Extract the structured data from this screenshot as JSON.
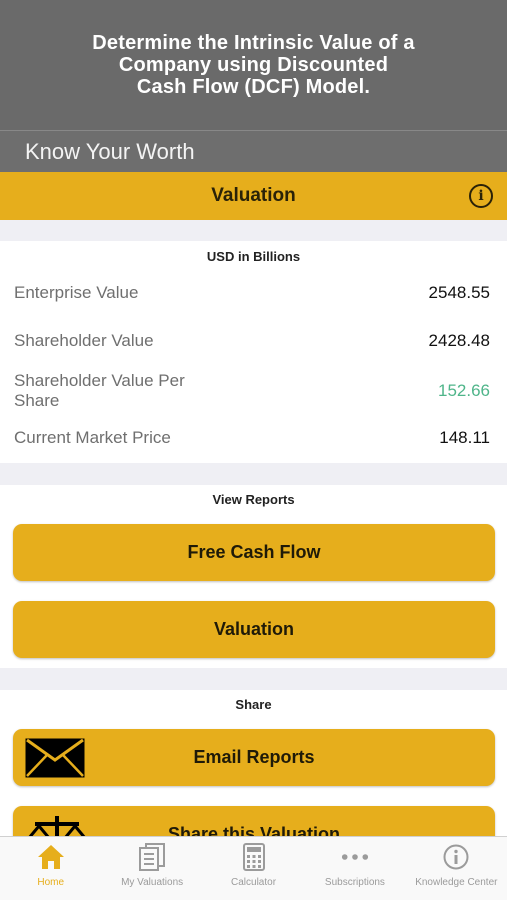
{
  "promo": {
    "text": "Determine the Intrinsic Value of a\nCompany using Discounted\nCash Flow (DCF) Model."
  },
  "app": {
    "title": "Know Your Worth"
  },
  "nav": {
    "title": "Valuation",
    "info_icon": "info-circle-icon"
  },
  "values": {
    "units": "USD in Billions",
    "rows": [
      {
        "label": "Enterprise Value",
        "value": "2548.55"
      },
      {
        "label": "Shareholder Value",
        "value": "2428.48"
      },
      {
        "label": "Shareholder Value Per Share",
        "value": "152.66",
        "color": "#4fb58a"
      },
      {
        "label": "Current Market Price",
        "value": "148.11"
      }
    ]
  },
  "reports": {
    "title": "View Reports",
    "buttons": [
      {
        "label": "Free Cash Flow"
      },
      {
        "label": "Valuation"
      }
    ]
  },
  "share": {
    "title": "Share",
    "buttons": [
      {
        "label": "Email Reports",
        "icon": "envelope-icon"
      },
      {
        "label": "Share this Valuation",
        "icon": "scale-icon"
      }
    ]
  },
  "tabs": [
    {
      "label": "Home",
      "icon": "home-icon",
      "active": true
    },
    {
      "label": "My Valuations",
      "icon": "documents-icon"
    },
    {
      "label": "Calculator",
      "icon": "calculator-icon"
    },
    {
      "label": "Subscriptions",
      "icon": "more-dots-icon"
    },
    {
      "label": "Knowledge Center",
      "icon": "info-icon"
    }
  ],
  "colors": {
    "accent": "#e6ae1c",
    "header_gray": "#6a6a6a",
    "positive": "#4fb58a"
  }
}
